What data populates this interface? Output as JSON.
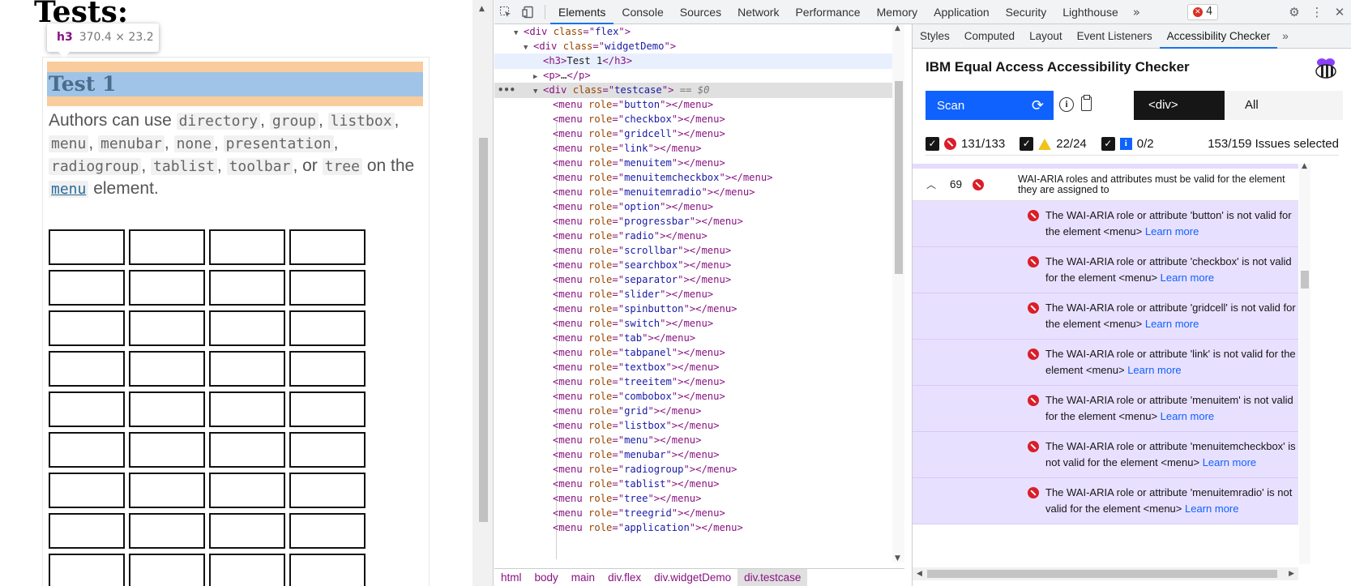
{
  "page": {
    "heading": "Tests:",
    "h3": "Test 1",
    "description_parts": [
      {
        "text": "Authors can use ",
        "code": false
      },
      {
        "text": "directory",
        "code": true
      },
      {
        "text": ", ",
        "code": false
      },
      {
        "text": "group",
        "code": true
      },
      {
        "text": ", ",
        "code": false
      },
      {
        "text": "listbox",
        "code": true
      },
      {
        "text": ", ",
        "code": false
      },
      {
        "text": "menu",
        "code": true
      },
      {
        "text": ", ",
        "code": false
      },
      {
        "text": "menubar",
        "code": true
      },
      {
        "text": ", ",
        "code": false
      },
      {
        "text": "none",
        "code": true
      },
      {
        "text": ", ",
        "code": false
      },
      {
        "text": "presentation",
        "code": true
      },
      {
        "text": ", ",
        "code": false
      },
      {
        "text": "radiogroup",
        "code": true
      },
      {
        "text": ", ",
        "code": false
      },
      {
        "text": "tablist",
        "code": true
      },
      {
        "text": ", ",
        "code": false
      },
      {
        "text": "toolbar",
        "code": true
      },
      {
        "text": ", or ",
        "code": false
      },
      {
        "text": "tree",
        "code": true
      },
      {
        "text": " on the ",
        "code": false
      },
      {
        "text": "menu",
        "code": "link"
      },
      {
        "text": " element.",
        "code": false
      }
    ],
    "grid_rows": 9,
    "grid_cols": 4
  },
  "tooltip": {
    "tag": "h3",
    "size": "370.4 × 23.2"
  },
  "devtools": {
    "tabs": [
      "Elements",
      "Console",
      "Sources",
      "Network",
      "Performance",
      "Memory",
      "Application",
      "Security",
      "Lighthouse"
    ],
    "active_tab": "Elements",
    "more": "»",
    "error_count": "4",
    "icons": [
      "inspect-icon",
      "device-icon",
      "gear-icon",
      "kebab-icon",
      "close-icon"
    ],
    "dom_lines": [
      {
        "indent": 2,
        "tri": "▼",
        "html": [
          [
            "tagc",
            "<div "
          ],
          [
            "attr",
            "class"
          ],
          [
            "tagc",
            "=\""
          ],
          [
            "val",
            "flex"
          ],
          [
            "tagc",
            "\">"
          ]
        ]
      },
      {
        "indent": 3,
        "tri": "▼",
        "html": [
          [
            "tagc",
            "<div "
          ],
          [
            "attr",
            "class"
          ],
          [
            "tagc",
            "=\""
          ],
          [
            "val",
            "widgetDemo"
          ],
          [
            "tagc",
            "\">"
          ]
        ]
      },
      {
        "indent": 4,
        "tri": "",
        "hover": true,
        "html": [
          [
            "tagc",
            "<h3>"
          ],
          [
            "txt",
            "Test 1"
          ],
          [
            "tagc",
            "</h3>"
          ]
        ]
      },
      {
        "indent": 4,
        "tri": "▶",
        "html": [
          [
            "tagc",
            "<p>"
          ],
          [
            "txt",
            "…"
          ],
          [
            "tagc",
            "</p>"
          ]
        ]
      },
      {
        "indent": 4,
        "tri": "▼",
        "selected": true,
        "dots": "•••",
        "html": [
          [
            "tagc",
            "<div "
          ],
          [
            "attr",
            "class"
          ],
          [
            "tagc",
            "=\""
          ],
          [
            "val",
            "testcase"
          ],
          [
            "tagc",
            "\">"
          ],
          [
            "eq",
            " == $0"
          ]
        ]
      },
      {
        "indent": 5,
        "role": "button"
      },
      {
        "indent": 5,
        "role": "checkbox"
      },
      {
        "indent": 5,
        "role": "gridcell"
      },
      {
        "indent": 5,
        "role": "link"
      },
      {
        "indent": 5,
        "role": "menuitem"
      },
      {
        "indent": 5,
        "role": "menuitemcheckbox"
      },
      {
        "indent": 5,
        "role": "menuitemradio"
      },
      {
        "indent": 5,
        "role": "option"
      },
      {
        "indent": 5,
        "role": "progressbar"
      },
      {
        "indent": 5,
        "role": "radio"
      },
      {
        "indent": 5,
        "role": "scrollbar"
      },
      {
        "indent": 5,
        "role": "searchbox"
      },
      {
        "indent": 5,
        "role": "separator"
      },
      {
        "indent": 5,
        "role": "slider"
      },
      {
        "indent": 5,
        "role": "spinbutton"
      },
      {
        "indent": 5,
        "role": "switch"
      },
      {
        "indent": 5,
        "role": "tab"
      },
      {
        "indent": 5,
        "role": "tabpanel"
      },
      {
        "indent": 5,
        "role": "textbox"
      },
      {
        "indent": 5,
        "role": "treeitem"
      },
      {
        "indent": 5,
        "role": "combobox"
      },
      {
        "indent": 5,
        "role": "grid"
      },
      {
        "indent": 5,
        "role": "listbox"
      },
      {
        "indent": 5,
        "role": "menu"
      },
      {
        "indent": 5,
        "role": "menubar"
      },
      {
        "indent": 5,
        "role": "radiogroup"
      },
      {
        "indent": 5,
        "role": "tablist"
      },
      {
        "indent": 5,
        "role": "tree"
      },
      {
        "indent": 5,
        "role": "treegrid"
      },
      {
        "indent": 5,
        "role": "application"
      }
    ],
    "breadcrumbs": [
      "html",
      "body",
      "main",
      "div.flex",
      "div.widgetDemo",
      "div.testcase"
    ],
    "active_crumb": "div.testcase"
  },
  "sidebar": {
    "tabs": [
      "Styles",
      "Computed",
      "Layout",
      "Event Listeners",
      "Accessibility Checker"
    ],
    "active_tab": "Accessibility Checker",
    "more": "»",
    "checker": {
      "title": "IBM Equal Access Accessibility Checker",
      "scan_label": "Scan",
      "element_toggle": "<div>",
      "all_toggle": "All",
      "violations": "131/133",
      "warnings": "22/24",
      "recommendations": "0/2",
      "selected_summary": "153/159 Issues selected",
      "group": {
        "count": "69",
        "title": "WAI-ARIA roles and attributes must be valid for the element they are assigned to"
      },
      "learn_more": "Learn more",
      "issues": [
        "The WAI-ARIA role or attribute 'button' is not valid for the element <menu>",
        "The WAI-ARIA role or attribute 'checkbox' is not valid for the element <menu>",
        "The WAI-ARIA role or attribute 'gridcell' is not valid for the element <menu>",
        "The WAI-ARIA role or attribute 'link' is not valid for the element <menu>",
        "The WAI-ARIA role or attribute 'menuitem' is not valid for the element <menu>",
        "The WAI-ARIA role or attribute 'menuitemcheckbox' is not valid for the element <menu>",
        "The WAI-ARIA role or attribute 'menuitemradio' is not valid for the element <menu>"
      ]
    }
  },
  "colors": {
    "accent_blue": "#0f62fe",
    "devtools_tab_accent": "#1a73e8",
    "violation_red": "#da1e28",
    "issue_row_bg": "#e8e0ff",
    "margin_overlay": "#f9cc9d",
    "content_overlay": "#9fc4e7"
  }
}
